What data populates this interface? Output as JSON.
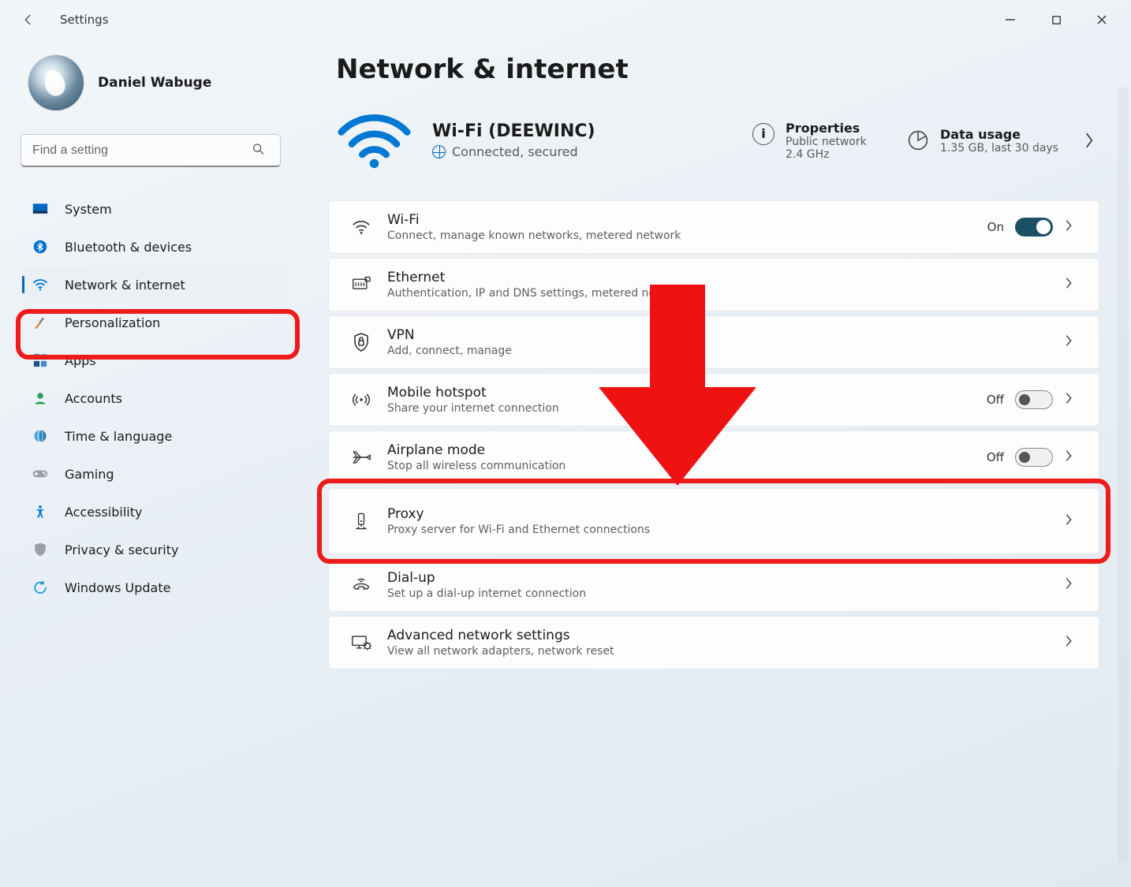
{
  "app": {
    "title": "Settings"
  },
  "user": {
    "name": "Daniel Wabuge"
  },
  "search": {
    "placeholder": "Find a setting"
  },
  "sidebar": {
    "items": [
      {
        "label": "System"
      },
      {
        "label": "Bluetooth & devices"
      },
      {
        "label": "Network & internet"
      },
      {
        "label": "Personalization"
      },
      {
        "label": "Apps"
      },
      {
        "label": "Accounts"
      },
      {
        "label": "Time & language"
      },
      {
        "label": "Gaming"
      },
      {
        "label": "Accessibility"
      },
      {
        "label": "Privacy & security"
      },
      {
        "label": "Windows Update"
      }
    ]
  },
  "page": {
    "title": "Network & internet",
    "connection": {
      "name": "Wi-Fi (DEEWINC)",
      "status": "Connected, secured"
    },
    "properties": {
      "heading": "Properties",
      "line1": "Public network",
      "line2": "2.4 GHz"
    },
    "usage": {
      "heading": "Data usage",
      "detail": "1.35 GB, last 30 days"
    }
  },
  "cards": {
    "wifi": {
      "title": "Wi-Fi",
      "sub": "Connect, manage known networks, metered network",
      "state": "On"
    },
    "ethernet": {
      "title": "Ethernet",
      "sub": "Authentication, IP and DNS settings, metered network"
    },
    "vpn": {
      "title": "VPN",
      "sub": "Add, connect, manage"
    },
    "hotspot": {
      "title": "Mobile hotspot",
      "sub": "Share your internet connection",
      "state": "Off"
    },
    "airplane": {
      "title": "Airplane mode",
      "sub": "Stop all wireless communication",
      "state": "Off"
    },
    "proxy": {
      "title": "Proxy",
      "sub": "Proxy server for Wi-Fi and Ethernet connections"
    },
    "dialup": {
      "title": "Dial-up",
      "sub": "Set up a dial-up internet connection"
    },
    "advanced": {
      "title": "Advanced network settings",
      "sub": "View all network adapters, network reset"
    }
  }
}
